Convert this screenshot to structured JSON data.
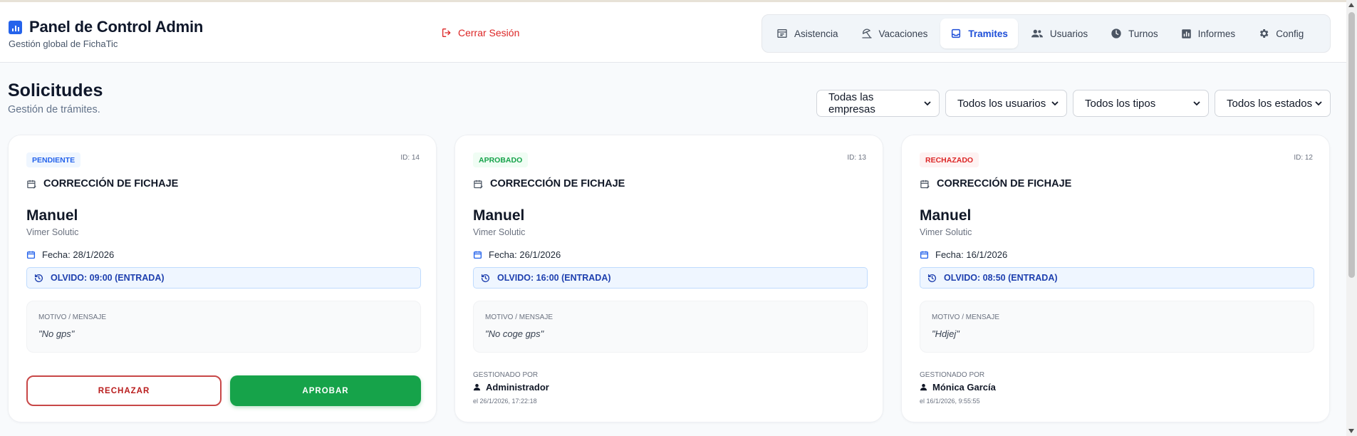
{
  "header": {
    "title": "Panel de Control Admin",
    "subtitle": "Gestión global de FichaTic",
    "logout_label": "Cerrar Sesión"
  },
  "nav": {
    "items": [
      {
        "label": "Asistencia",
        "icon": "attendance-icon"
      },
      {
        "label": "Vacaciones",
        "icon": "beach-umbrella-icon"
      },
      {
        "label": "Tramites",
        "icon": "inbox-icon",
        "active": true
      },
      {
        "label": "Usuarios",
        "icon": "users-icon"
      },
      {
        "label": "Turnos",
        "icon": "clock-icon"
      },
      {
        "label": "Informes",
        "icon": "bar-chart-icon"
      },
      {
        "label": "Config",
        "icon": "gear-icon"
      }
    ]
  },
  "page": {
    "title": "Solicitudes",
    "subtitle": "Gestión de trámites."
  },
  "filters": {
    "company": "Todas las empresas",
    "user": "Todos los usuarios",
    "type": "Todos los tipos",
    "status": "Todos los estados"
  },
  "cards": [
    {
      "status": "PENDIENTE",
      "id": "ID: 14",
      "type": "CORRECCIÓN DE FICHAJE",
      "user": "Manuel",
      "company": "Vimer Solutic",
      "date": "Fecha: 28/1/2026",
      "olvido": "OLVIDO: 09:00 (ENTRADA)",
      "motivo_label": "MOTIVO / MENSAJE",
      "motivo": "\"No gps\"",
      "reject_label": "RECHAZAR",
      "approve_label": "APROBAR"
    },
    {
      "status": "APROBADO",
      "id": "ID: 13",
      "type": "CORRECCIÓN DE FICHAJE",
      "user": "Manuel",
      "company": "Vimer Solutic",
      "date": "Fecha: 26/1/2026",
      "olvido": "OLVIDO: 16:00 (ENTRADA)",
      "motivo_label": "MOTIVO / MENSAJE",
      "motivo": "\"No coge gps\"",
      "managed_label": "GESTIONADO POR",
      "managed_by": "Administrador",
      "managed_date": "el 26/1/2026, 17:22:18"
    },
    {
      "status": "RECHAZADO",
      "id": "ID: 12",
      "type": "CORRECCIÓN DE FICHAJE",
      "user": "Manuel",
      "company": "Vimer Solutic",
      "date": "Fecha: 16/1/2026",
      "olvido": "OLVIDO: 08:50 (ENTRADA)",
      "motivo_label": "MOTIVO / MENSAJE",
      "motivo": "\"Hdjej\"",
      "managed_label": "GESTIONADO POR",
      "managed_by": "Mónica García",
      "managed_date": "el 16/1/2026, 9:55:55"
    }
  ],
  "colors": {
    "accent": "#2563eb",
    "approve": "#16a34a",
    "reject": "#dc2626"
  }
}
